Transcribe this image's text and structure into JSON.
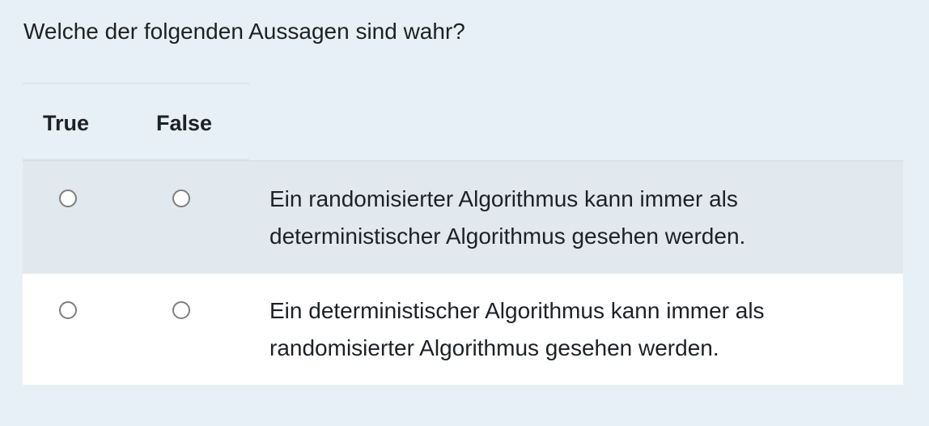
{
  "question": {
    "text": "Welche der folgenden Aussagen sind wahr?"
  },
  "matrix": {
    "columns": {
      "true_label": "True",
      "false_label": "False"
    },
    "rows": [
      {
        "line1": "Ein randomisierter Algorithmus kann immer als",
        "line2": "deterministischer Algorithmus gesehen werden."
      },
      {
        "line1": "Ein deterministischer Algorithmus kann immer als",
        "line2": "randomisierter Algorithmus gesehen werden."
      }
    ]
  },
  "colors": {
    "page_background": "#e7f0f7",
    "odd_row_background": "#e1e9ee",
    "even_row_background": "#ffffff",
    "radio_border": "#7e7e7e",
    "text": "#1d2125"
  }
}
